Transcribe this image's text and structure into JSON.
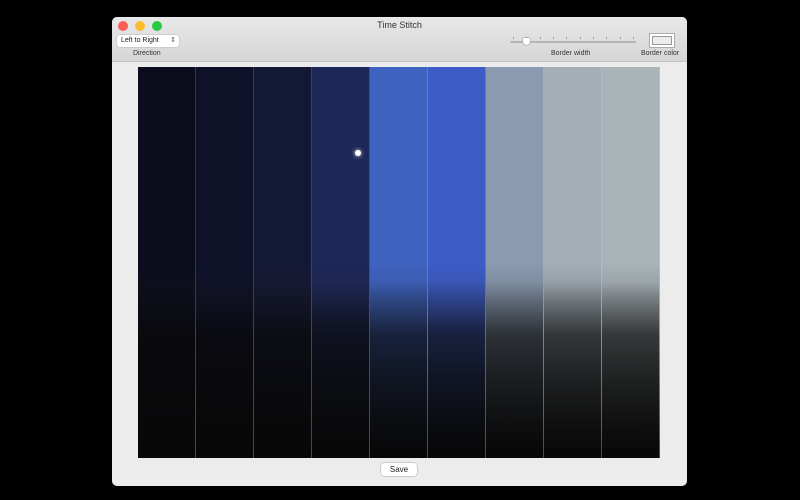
{
  "window": {
    "title": "Time Stitch"
  },
  "toolbar": {
    "direction": {
      "value": "Left to Right",
      "label": "Direction"
    },
    "border_width": {
      "label": "Border width",
      "ticks": 10,
      "value_tick": 1
    },
    "border_color": {
      "label": "Border color",
      "value": "#ebebeb"
    }
  },
  "preview": {
    "strips": [
      "#0b0c1c",
      "#0e1128",
      "#131834",
      "#1d2758",
      "#3e63c0",
      "#3d5cc8",
      "#8a9ab0",
      "#a3aeb7",
      "#a9b3b8"
    ]
  },
  "actions": {
    "save_label": "Save"
  }
}
